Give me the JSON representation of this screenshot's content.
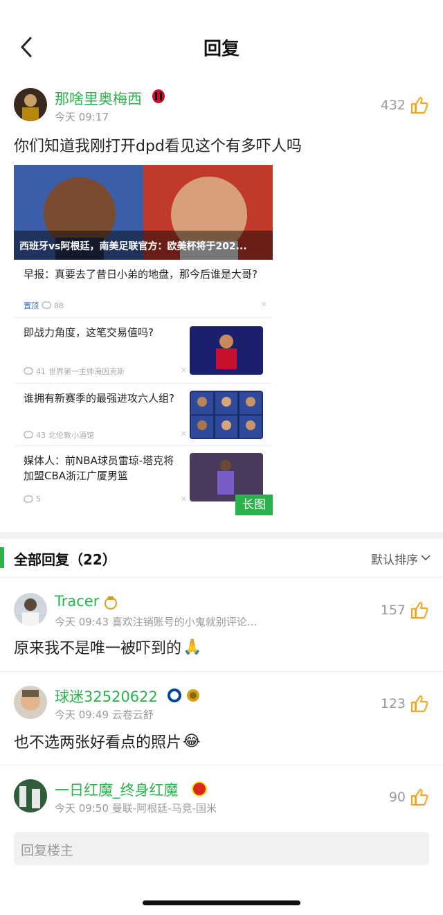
{
  "header": {
    "title": "回复"
  },
  "post": {
    "username": "那啥里奥梅西",
    "time": "今天 09:17",
    "likes": "432",
    "text": "你们知道我刚打开dpd看见这个有多吓人吗",
    "screenshot": {
      "hero_caption": "西班牙vs阿根廷，南美足联官方：欧美杯将于202...",
      "items": [
        {
          "title": "早报：真要去了昔日小弟的地盘，那今后谁是大哥?",
          "tag": "置顶",
          "comments": "88",
          "source": ""
        },
        {
          "title": "即战力角度，这笔交易值吗?",
          "tag": "",
          "comments": "41",
          "source": "世界第一主帅海因克斯"
        },
        {
          "title": "谁拥有新赛季的最强进攻六人组?",
          "tag": "",
          "comments": "43",
          "source": "北伦敦小酒馆"
        },
        {
          "title": "媒体人：前NBA球员雷琼-塔克将加盟CBA浙江广厦男篮",
          "tag": "",
          "comments": "5",
          "source": ""
        }
      ],
      "long_image_badge": "长图"
    }
  },
  "replies_section": {
    "title": "全部回复（22）",
    "sort_label": "默认排序"
  },
  "replies": [
    {
      "username": "Tracer",
      "time": "今天 09:43",
      "extra": "喜欢注销账号的小鬼就别评论...",
      "likes": "157",
      "text": "原来我不是唯一被吓到的",
      "emoji": "🙏"
    },
    {
      "username": "球迷32520622",
      "time": "今天 09:49",
      "extra": "云卷云舒",
      "likes": "123",
      "text": "也不选两张好看点的照片",
      "emoji": "😂"
    },
    {
      "username": "一日红魔_终身红魔",
      "time": "今天 09:50",
      "extra": "曼联-阿根廷-马竞-国米",
      "likes": "90",
      "text": "",
      "emoji": ""
    }
  ],
  "input": {
    "placeholder": "回复楼主"
  },
  "colors": {
    "accent": "#2bb24c",
    "like_icon": "#f5a623"
  },
  "icons": [
    "back-chevron-icon",
    "thumbs-up-icon",
    "chevron-down-icon",
    "comment-icon",
    "close-icon"
  ]
}
